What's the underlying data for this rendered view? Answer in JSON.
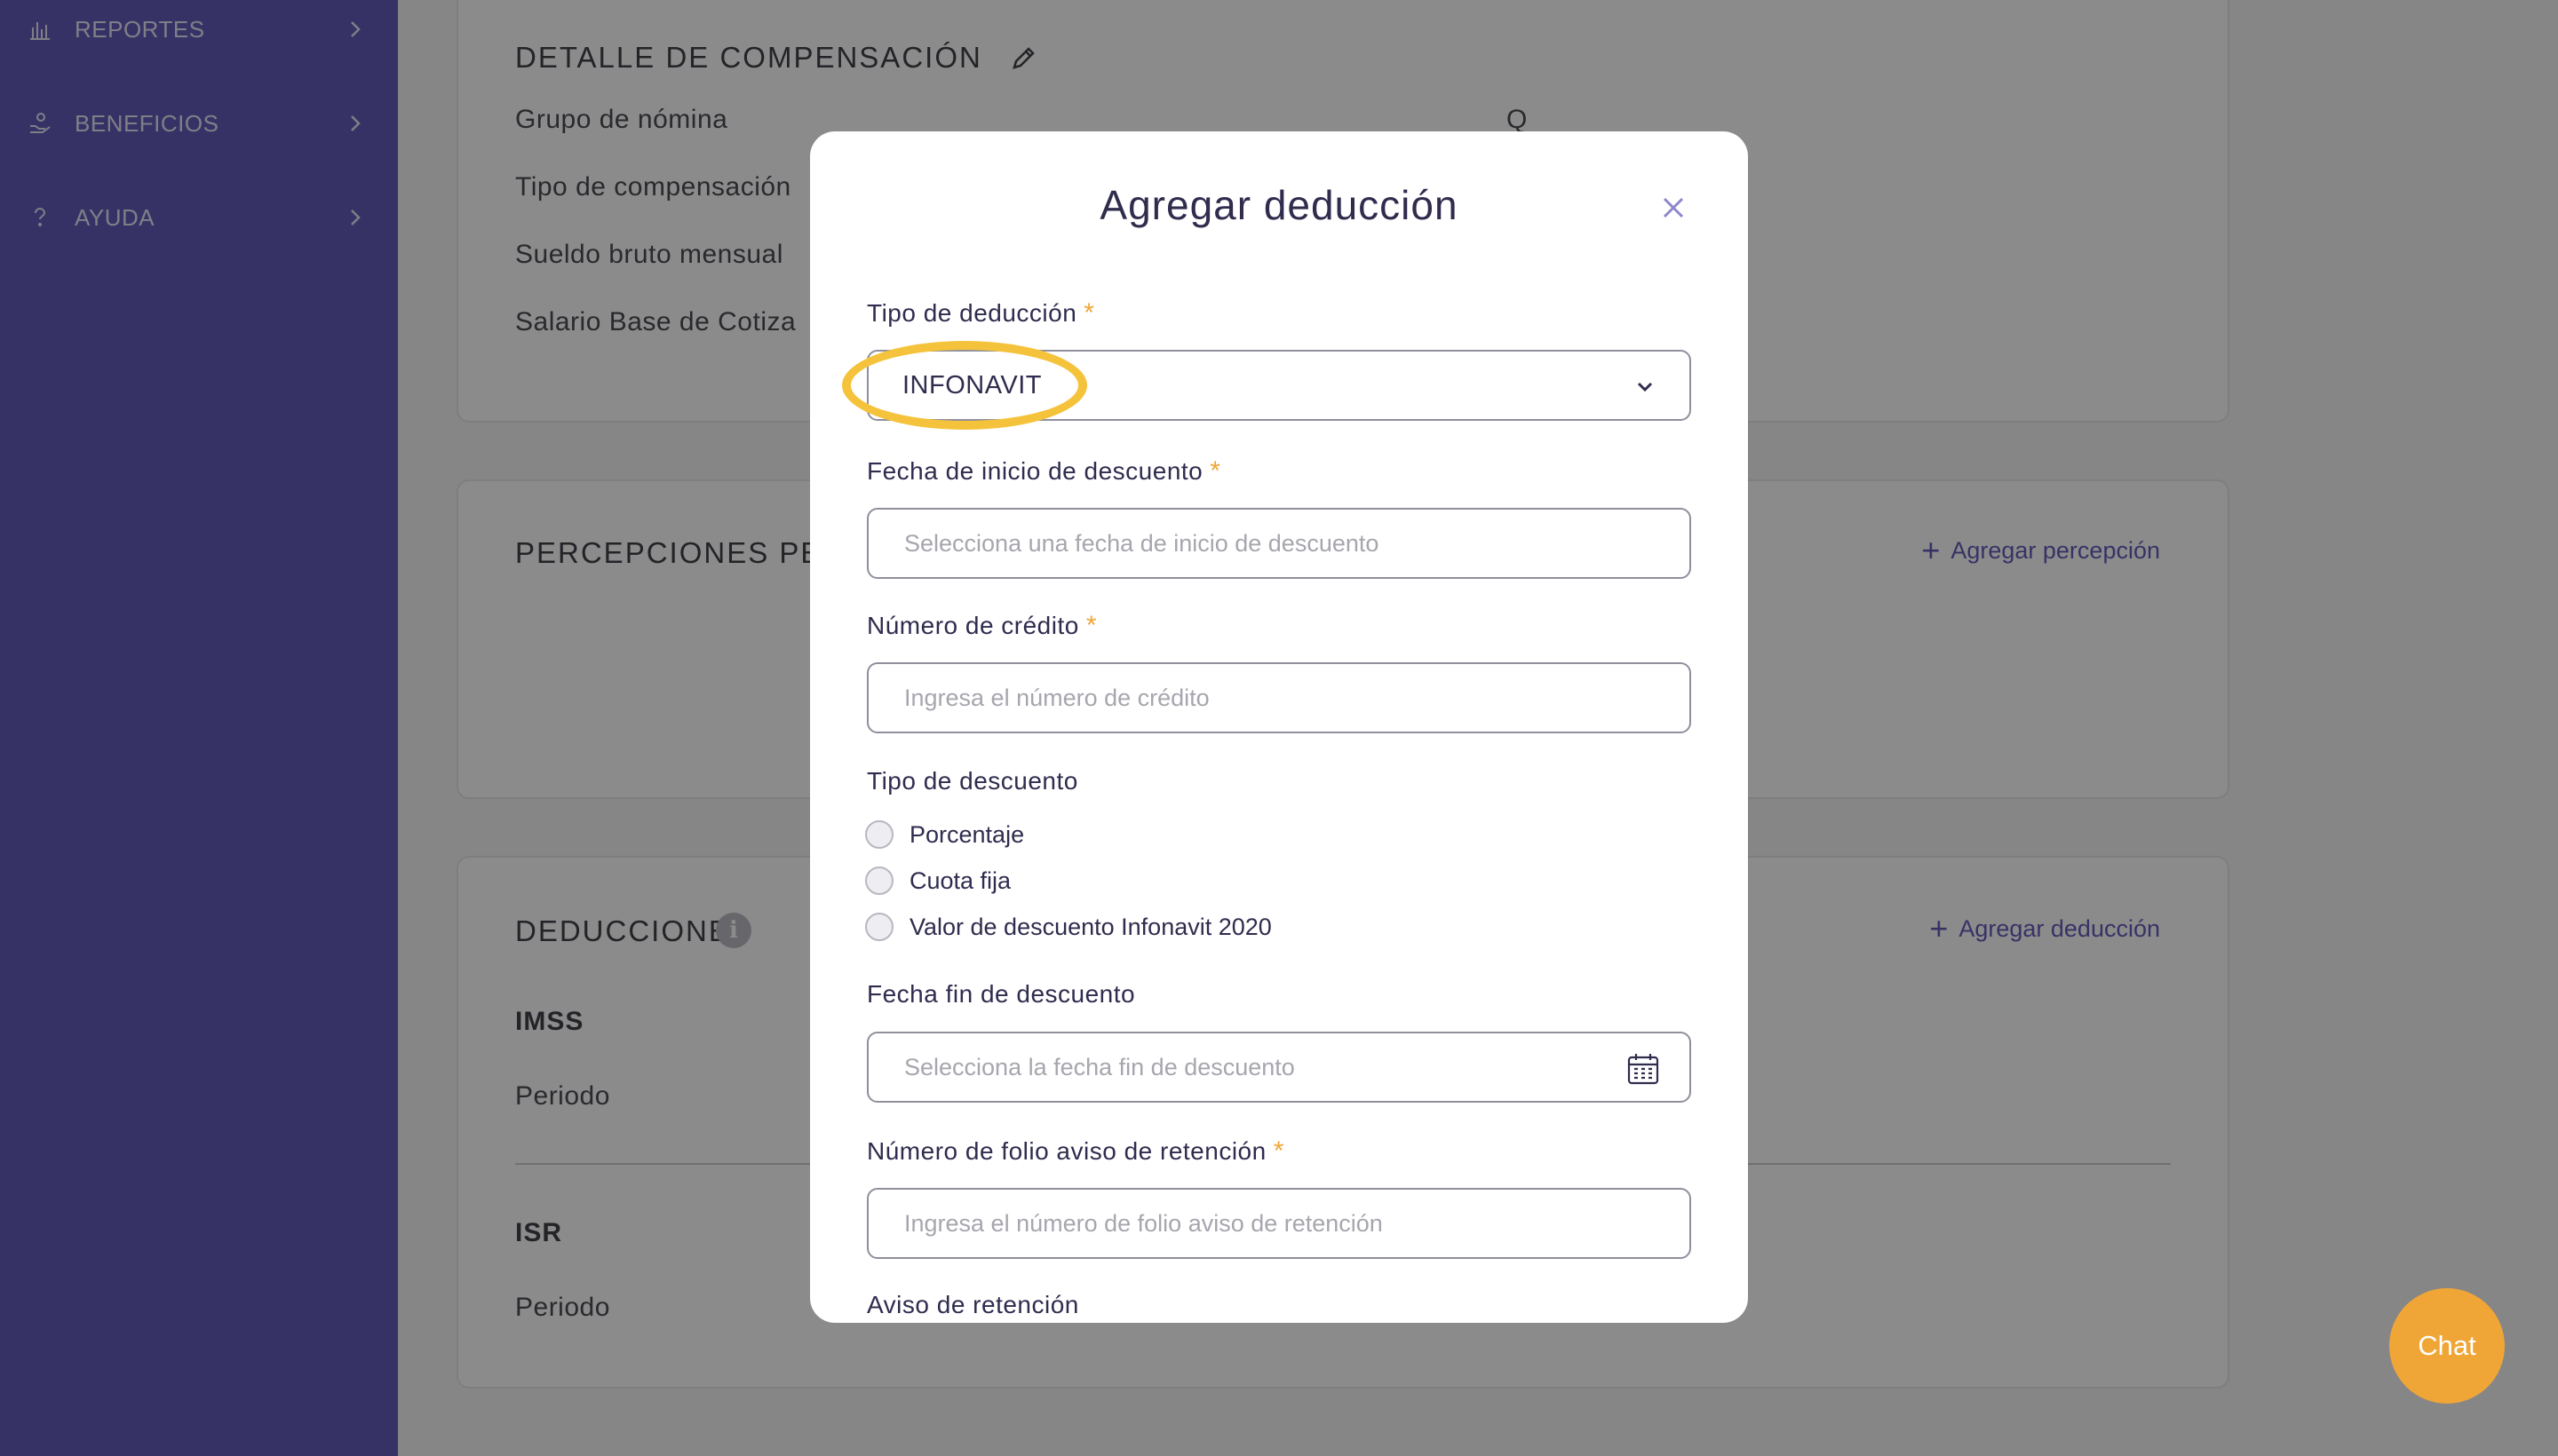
{
  "sidebar": {
    "items": [
      {
        "label": "REPORTES",
        "icon": "bar-chart-icon"
      },
      {
        "label": "BENEFICIOS",
        "icon": "hand-coins-icon"
      },
      {
        "label": "AYUDA",
        "icon": "question-icon"
      }
    ]
  },
  "compensation": {
    "title": "DETALLE DE COMPENSACIÓN",
    "fields": [
      {
        "label": "Grupo de nómina",
        "value": "Q"
      },
      {
        "label": "Tipo de compensación"
      },
      {
        "label": "Sueldo bruto mensual"
      },
      {
        "label": "Salario Base de Cotiza"
      }
    ]
  },
  "perceptions": {
    "title": "PERCEPCIONES PE",
    "add_label": "Agregar percepción"
  },
  "deductions": {
    "title": "DEDUCCIONES",
    "add_label": "Agregar deducción",
    "groups": [
      {
        "name": "IMSS",
        "period_label": "Periodo"
      },
      {
        "name": "ISR",
        "period_label": "Periodo"
      }
    ]
  },
  "modal": {
    "title": "Agregar deducción",
    "deduction_type": {
      "label": "Tipo de deducción",
      "value": "INFONAVIT"
    },
    "start_date": {
      "label": "Fecha de inicio de descuento",
      "placeholder": "Selecciona una fecha de inicio de descuento"
    },
    "credit_number": {
      "label": "Número de crédito",
      "placeholder": "Ingresa el número de crédito"
    },
    "discount_type": {
      "label": "Tipo de descuento",
      "options": [
        "Porcentaje",
        "Cuota fija",
        "Valor de descuento Infonavit 2020"
      ]
    },
    "end_date": {
      "label": "Fecha fin de descuento",
      "placeholder": "Selecciona la fecha fin de descuento"
    },
    "folio": {
      "label": "Número de folio aviso de retención",
      "placeholder": "Ingresa el número de folio aviso de retención"
    },
    "notice_label": "Aviso de retención",
    "required_mark": "*"
  },
  "chat": {
    "label": "Chat"
  },
  "colors": {
    "sidebar": "#574db5",
    "accent": "#f0a637",
    "highlight": "#f5c33b"
  }
}
